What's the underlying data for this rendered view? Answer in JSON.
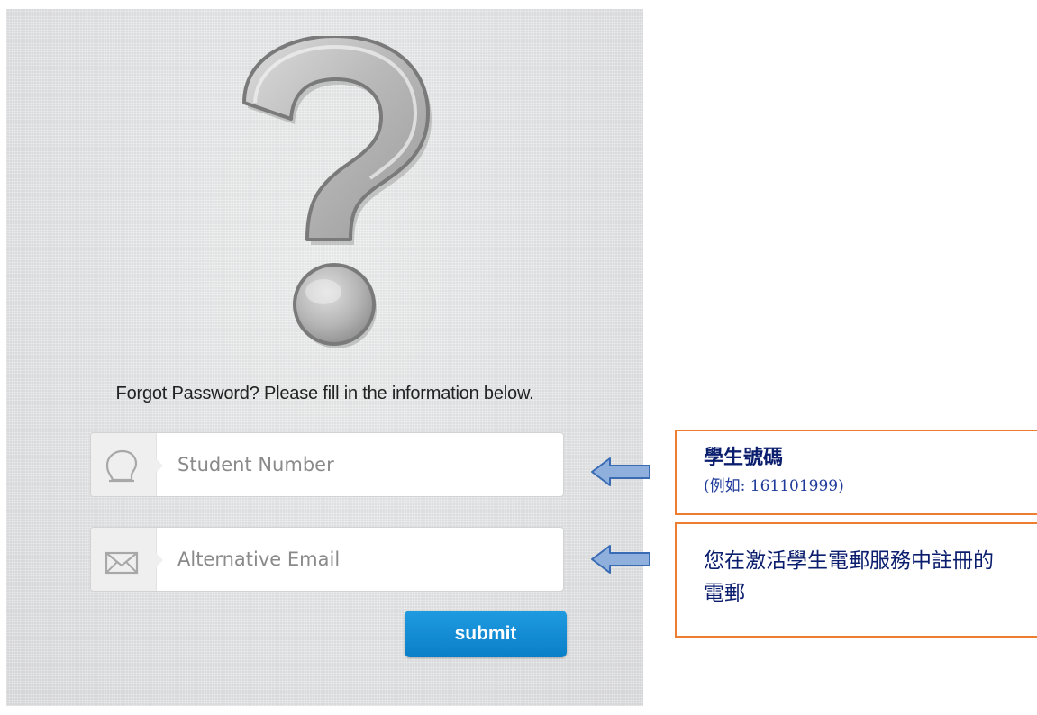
{
  "form": {
    "instruction": "Forgot Password? Please fill in the information below.",
    "student_number": {
      "placeholder": "Student Number",
      "value": "",
      "icon": "user-head-icon"
    },
    "alternative_email": {
      "placeholder": "Alternative Email",
      "value": "",
      "icon": "envelope-icon"
    },
    "submit_label": "submit"
  },
  "decorations": {
    "hero_icon": "question-mark-icon",
    "arrow_icon": "left-arrow-icon"
  },
  "callouts": {
    "student_number": {
      "title": "學生號碼",
      "subtitle": "(例如: 161101999)"
    },
    "alternative_email": {
      "text": "您在激活學生電郵服務中註冊的電郵"
    }
  },
  "colors": {
    "submit_button": "#0a87d4",
    "arrow_fill": "#8fb0dc",
    "arrow_stroke": "#3a6bb5",
    "callout_border": "#ec7d31",
    "callout_text": "#0b1e6e"
  }
}
